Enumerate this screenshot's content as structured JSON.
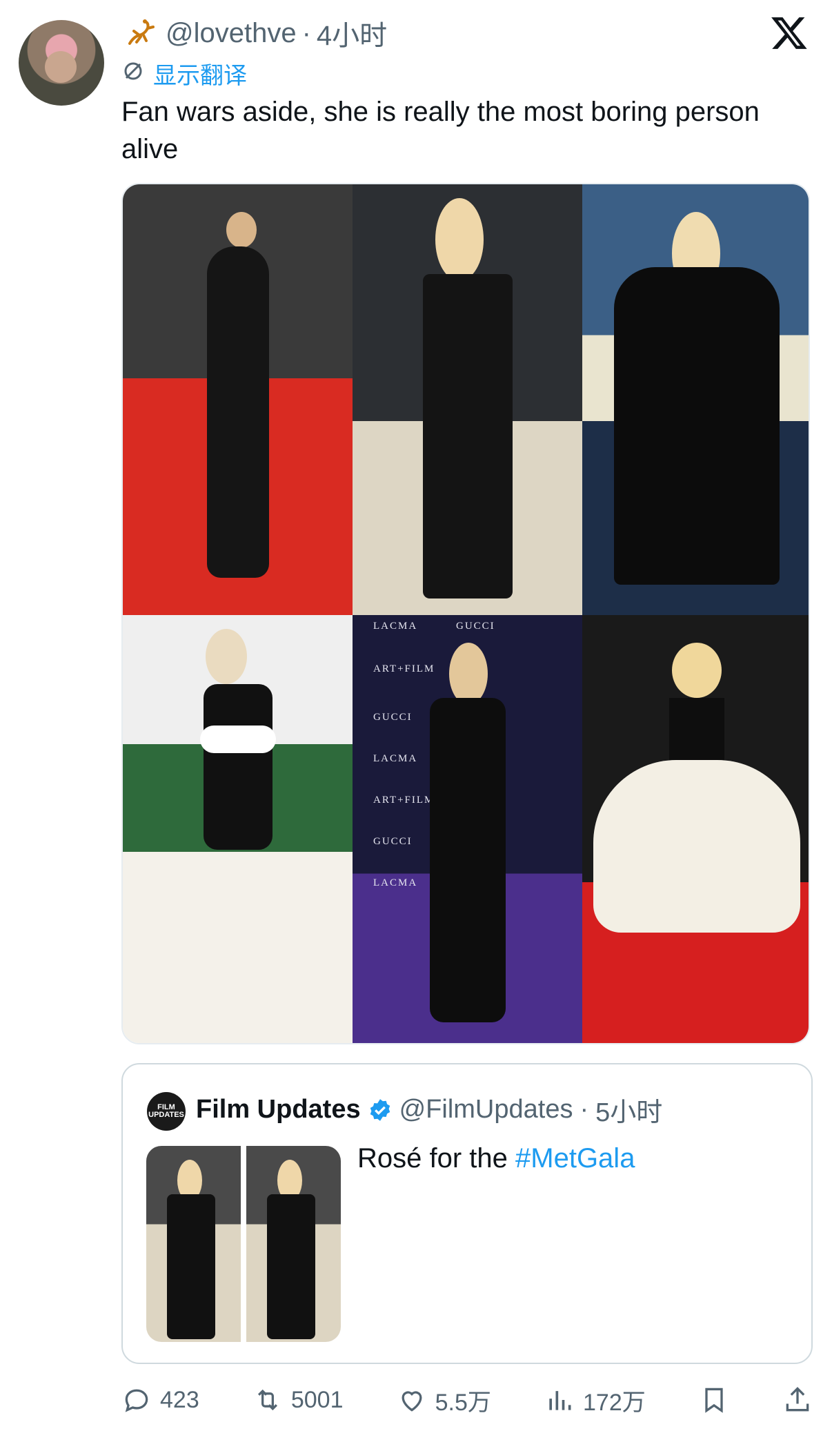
{
  "tweet": {
    "handle": "@lovethve",
    "separator": "·",
    "time": "4小时",
    "translate_label": "显示翻译",
    "text": "Fan wars aside, she is really the most boring person alive"
  },
  "quote": {
    "name": "Film Updates",
    "handle": "@FilmUpdates",
    "separator": "·",
    "time": "5小时",
    "text_prefix": "Rosé for the ",
    "hashtag": "#MetGala",
    "avatar_text": "FILM UPDATES"
  },
  "photo_labels": {
    "lacma": "LACMA",
    "gucci": "GUCCI",
    "artfilm": "ART+FILM"
  },
  "actions": {
    "replies": "423",
    "reposts": "5001",
    "likes": "5.5万",
    "views": "172万"
  },
  "colors": {
    "accent": "#1d9bf0",
    "muted": "#536471",
    "text": "#0f1419"
  },
  "icons": [
    "x-logo-icon",
    "scorpion-icon",
    "globe-icon",
    "verified-icon",
    "reply-icon",
    "repost-icon",
    "like-icon",
    "views-icon",
    "bookmark-icon",
    "share-icon"
  ]
}
